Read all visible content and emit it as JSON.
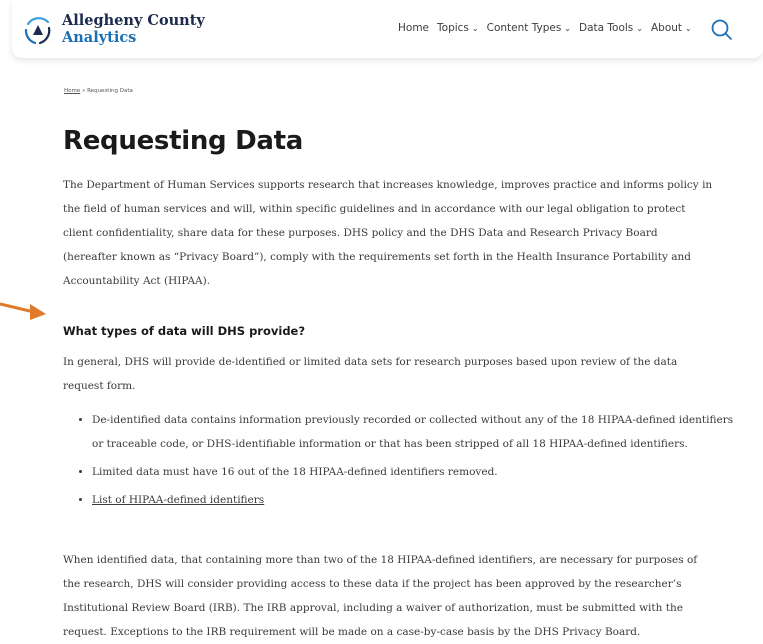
{
  "brand": {
    "line1": "Allegheny County",
    "line2": "Analytics"
  },
  "nav": {
    "items": [
      {
        "label": "Home",
        "has_menu": false
      },
      {
        "label": "Topics",
        "has_menu": true
      },
      {
        "label": "Content Types",
        "has_menu": true
      },
      {
        "label": "Data Tools",
        "has_menu": true
      },
      {
        "label": "About",
        "has_menu": true
      }
    ],
    "search_icon": "search-icon"
  },
  "breadcrumb": {
    "home": "Home",
    "separator": "»",
    "current": "Requesting Data"
  },
  "page": {
    "title": "Requesting Data",
    "intro": "The Department of Human Services supports research that increases knowledge, improves practice and informs policy in the field of human services and will, within specific guidelines and in accordance with our legal obligation to protect client confidentiality, share data for these purposes. DHS policy and the DHS Data and Research Privacy Board (hereafter known as “Privacy Board”), comply with the requirements set forth in the Health Insurance Portability and Accountability Act (HIPAA).",
    "section_heading": "What types of data will DHS provide?",
    "section_intro": "In general, DHS will provide de-identified or limited data sets for research purposes based upon review of the data request form.",
    "bullets": [
      "De-identified data contains information previously recorded or collected without any of the 18 HIPAA-defined identifiers or traceable code, or DHS-identifiable information or that has been stripped of all 18 HIPAA-defined identifiers.",
      "Limited data must have 16 out of the 18 HIPAA-defined identifiers removed."
    ],
    "link_bullet": "List of HIPAA-defined identifiers",
    "closing": "When identified data, that containing more than two of the 18 HIPAA-defined identifiers, are necessary for purposes of the research, DHS will consider providing access to these data if the project has been approved by the researcher’s Institutional Review Board (IRB). The IRB approval, including a waiver of authorization, must be submitted with the request. Exceptions to the IRB requirement will be made on a case-by-case basis by the DHS Privacy Board."
  },
  "colors": {
    "brand_dark": "#1b2a4e",
    "brand_blue": "#1b6fb6",
    "annotation_arrow": "#e07a2a",
    "text": "#3a3a3a"
  }
}
